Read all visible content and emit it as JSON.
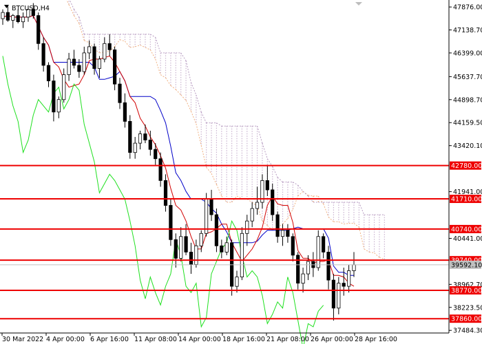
{
  "chart_data": {
    "type": "candlestick",
    "symbol_label": "BTCUSD,H4",
    "y_range": [
      37400,
      48100
    ],
    "y_ticks": [
      {
        "value": 47876.0,
        "label": "47876.00"
      },
      {
        "value": 47138.7,
        "label": "47138.70"
      },
      {
        "value": 46399.0,
        "label": "46399.00"
      },
      {
        "value": 45637.7,
        "label": "45637.70"
      },
      {
        "value": 44898.7,
        "label": "44898.70"
      },
      {
        "value": 44159.5,
        "label": "44159.50"
      },
      {
        "value": 43420.1,
        "label": "43420.10"
      },
      {
        "value": 41941.0,
        "label": "41941.00"
      },
      {
        "value": 40441.0,
        "label": "40441.00"
      },
      {
        "value": 38962.7,
        "label": "38962.70"
      },
      {
        "value": 38223.5,
        "label": "38223.50"
      },
      {
        "value": 37484.3,
        "label": "37484.30"
      }
    ],
    "x_labels": [
      "30 Mar 2022",
      "4 Apr 00:00",
      "6 Apr 16:00",
      "11 Apr 08:00",
      "14 Apr 00:00",
      "18 Apr 16:00",
      "21 Apr 08:00",
      "26 Apr 00:00",
      "28 Apr 16:00"
    ],
    "levels": [
      {
        "value": 42780.0,
        "label": "42780.00"
      },
      {
        "value": 41710.0,
        "label": "41710.00"
      },
      {
        "value": 40740.0,
        "label": "40740.00"
      },
      {
        "value": 39740.0,
        "label": "39740.00"
      },
      {
        "value": 38770.0,
        "label": "38770.00"
      },
      {
        "value": 37860.0,
        "label": "37860.00"
      }
    ],
    "current_price": {
      "value": 39592.1,
      "label": "39592.10"
    },
    "candles": [
      [
        47500,
        47800,
        47300,
        47700
      ],
      [
        47700,
        47900,
        47400,
        47450
      ],
      [
        47450,
        47650,
        47200,
        47600
      ],
      [
        47600,
        47800,
        47350,
        47400
      ],
      [
        47400,
        47700,
        47200,
        47550
      ],
      [
        47550,
        47900,
        47400,
        47800
      ],
      [
        47800,
        48000,
        47500,
        47600
      ],
      [
        47600,
        47700,
        46500,
        46700
      ],
      [
        46700,
        46900,
        45800,
        46000
      ],
      [
        46000,
        46100,
        45300,
        45500
      ],
      [
        45500,
        45700,
        44200,
        44500
      ],
      [
        44500,
        45000,
        44300,
        44900
      ],
      [
        44900,
        45900,
        44800,
        45700
      ],
      [
        45700,
        46400,
        45500,
        46200
      ],
      [
        46200,
        46500,
        45900,
        46000
      ],
      [
        46000,
        46200,
        45600,
        45800
      ],
      [
        45800,
        46600,
        45700,
        46400
      ],
      [
        46400,
        46800,
        46200,
        46600
      ],
      [
        46600,
        46700,
        45700,
        45900
      ],
      [
        45900,
        46300,
        45600,
        46200
      ],
      [
        46200,
        46900,
        46100,
        46700
      ],
      [
        46700,
        47000,
        46300,
        46500
      ],
      [
        46500,
        46600,
        45200,
        45400
      ],
      [
        45400,
        45600,
        44600,
        44800
      ],
      [
        44800,
        45100,
        44000,
        44200
      ],
      [
        44200,
        44400,
        43000,
        43200
      ],
      [
        43200,
        43700,
        43000,
        43500
      ],
      [
        43500,
        43900,
        43300,
        43800
      ],
      [
        43800,
        44100,
        43500,
        43600
      ],
      [
        43600,
        43900,
        43100,
        43300
      ],
      [
        43300,
        43500,
        42800,
        43000
      ],
      [
        43000,
        43200,
        42100,
        42300
      ],
      [
        42300,
        42500,
        41300,
        41500
      ],
      [
        41500,
        41700,
        40200,
        40400
      ],
      [
        40400,
        40600,
        39500,
        39800
      ],
      [
        39800,
        40800,
        39700,
        40500
      ],
      [
        40500,
        40900,
        39900,
        40000
      ],
      [
        40000,
        40300,
        39300,
        39600
      ],
      [
        39600,
        40400,
        39500,
        40200
      ],
      [
        40200,
        40700,
        40000,
        40600
      ],
      [
        40600,
        41900,
        40500,
        41700
      ],
      [
        41700,
        42000,
        41000,
        41200
      ],
      [
        41200,
        41400,
        40000,
        40200
      ],
      [
        40200,
        40400,
        39800,
        40000
      ],
      [
        40000,
        40500,
        39900,
        40300
      ],
      [
        40300,
        40400,
        38600,
        38900
      ],
      [
        38900,
        39400,
        38700,
        39200
      ],
      [
        39200,
        40800,
        39100,
        40600
      ],
      [
        40600,
        41200,
        40200,
        41000
      ],
      [
        41000,
        41600,
        40800,
        41400
      ],
      [
        41400,
        42100,
        41200,
        41600
      ],
      [
        41600,
        42500,
        41400,
        42300
      ],
      [
        42300,
        42800,
        41800,
        42000
      ],
      [
        42000,
        42200,
        41000,
        41200
      ],
      [
        41200,
        41300,
        40300,
        40500
      ],
      [
        40500,
        40900,
        40200,
        40700
      ],
      [
        40700,
        40900,
        40300,
        40500
      ],
      [
        40500,
        40600,
        39700,
        39900
      ],
      [
        39900,
        40000,
        38800,
        39000
      ],
      [
        39000,
        39500,
        38700,
        39300
      ],
      [
        39300,
        39900,
        39100,
        39700
      ],
      [
        39700,
        40000,
        39200,
        39500
      ],
      [
        39500,
        40700,
        39400,
        40500
      ],
      [
        40500,
        40600,
        39800,
        40000
      ],
      [
        40000,
        40200,
        38800,
        39100
      ],
      [
        39100,
        39300,
        37800,
        38200
      ],
      [
        38200,
        39200,
        38000,
        39000
      ],
      [
        39000,
        39500,
        38600,
        38900
      ],
      [
        38900,
        39600,
        38700,
        39400
      ],
      [
        39400,
        40000,
        39200,
        39592
      ]
    ]
  }
}
